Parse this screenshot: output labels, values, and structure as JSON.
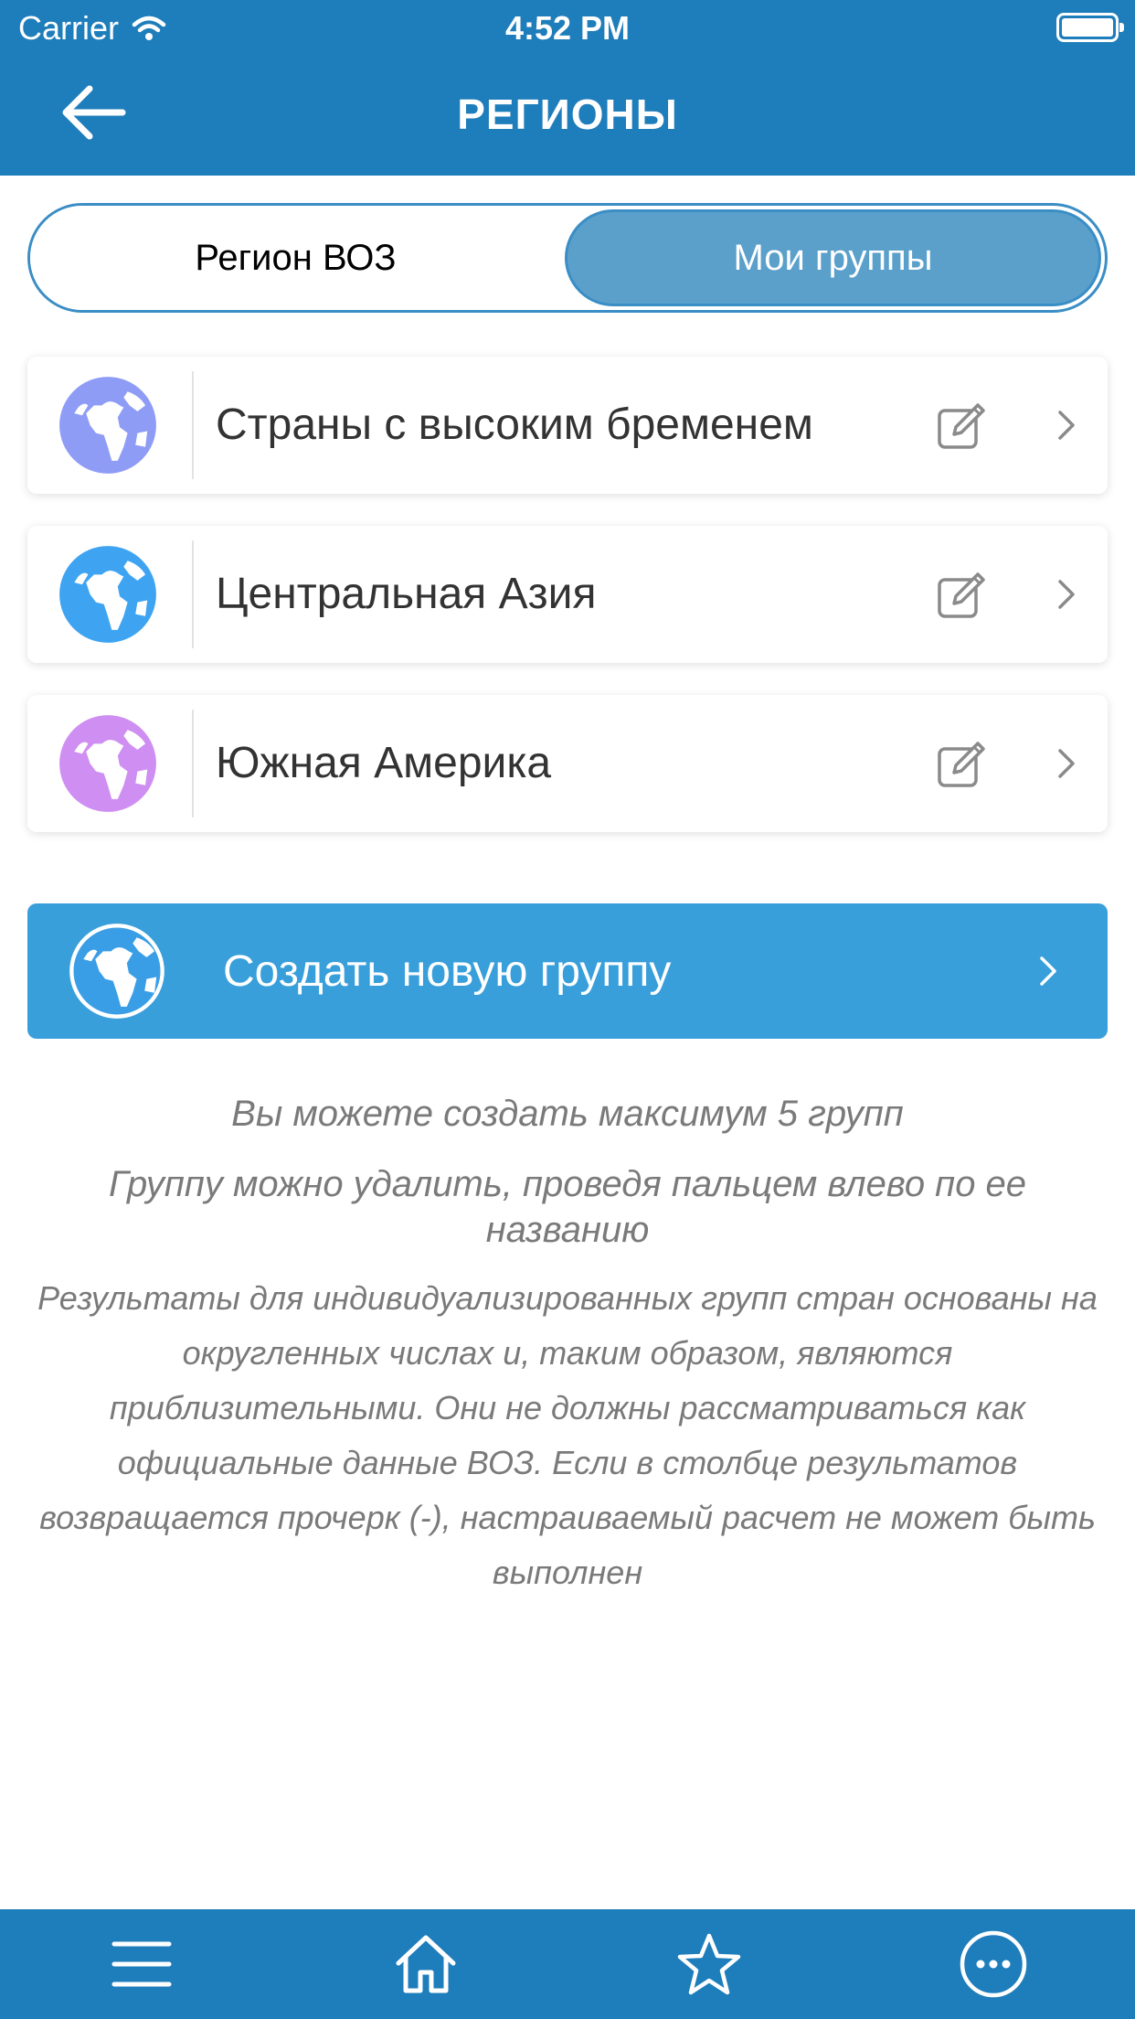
{
  "status_bar": {
    "carrier": "Carrier",
    "time": "4:52 PM"
  },
  "header": {
    "title": "РЕГИОНЫ"
  },
  "segmented": {
    "tab_who": "Регион ВОЗ",
    "tab_groups": "Мои группы",
    "active": "tab_groups"
  },
  "groups": [
    {
      "name": "Страны с высоким бременем",
      "globe_color": "#8e9cf6"
    },
    {
      "name": "Центральная Азия",
      "globe_color": "#3ea4f2"
    },
    {
      "name": "Южная Америка",
      "globe_color": "#cf8ff2"
    }
  ],
  "create_button": {
    "label": "Создать новую группу"
  },
  "notes": {
    "max_groups": "Вы можете создать максимум 5 групп",
    "delete_hint": "Группу можно удалить, проведя пальцем влево по ее названию",
    "disclaimer": "Результаты для индивидуализированных групп стран основаны на округленных числах и, таким образом, являются приблизительными. Они не должны рассматриваться как официальные данные ВОЗ. Если в столбце результатов возвращается прочерк (-), настраиваемый расчет не может быть выполнен"
  },
  "colors": {
    "primary": "#1e7dbb",
    "accent": "#389fdb",
    "segment_active": "#5aa0cb"
  },
  "tabbar": {
    "icons": [
      "menu-icon",
      "home-icon",
      "star-icon",
      "more-icon"
    ]
  }
}
